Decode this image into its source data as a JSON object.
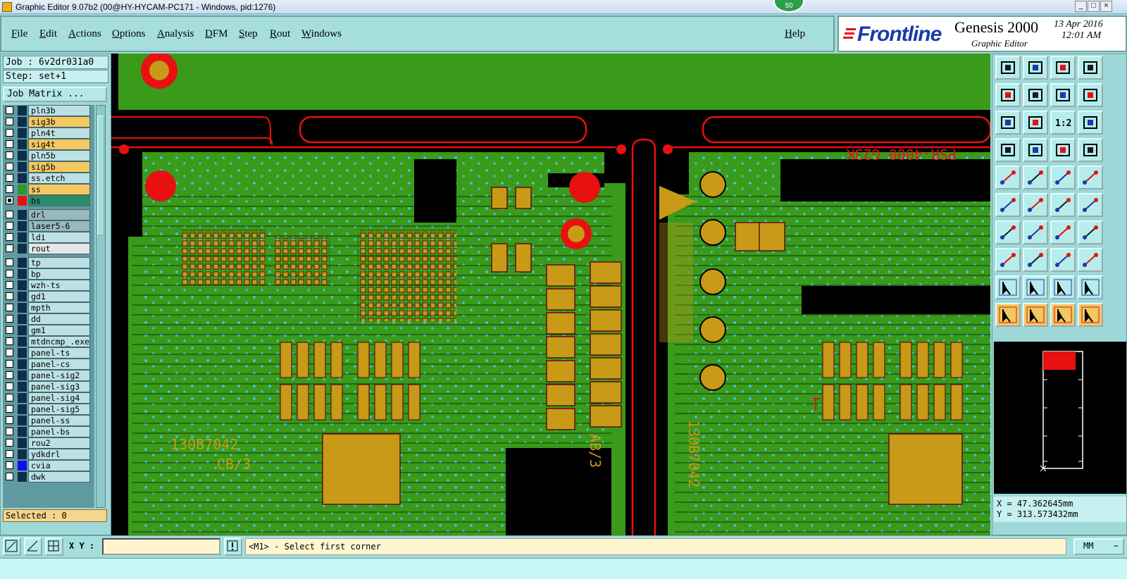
{
  "window": {
    "title": "Graphic Editor 9.07b2 (00@HY-HYCAM-PC171 - Windows, pid:1276)",
    "badge": "50",
    "controls": [
      "_",
      "□",
      "×"
    ]
  },
  "menu": [
    "File",
    "Edit",
    "Actions",
    "Options",
    "Analysis",
    "DFM",
    "Step",
    "Rout",
    "Windows"
  ],
  "help": "Help",
  "branding": {
    "logo": "Frontline",
    "product": "Genesis 2000",
    "subtitle": "Graphic Editor",
    "date": "13 Apr 2016",
    "time": "12:01 AM"
  },
  "job": {
    "job_line": "Job : 6v2dr031a0",
    "step_line": "Step: set+1",
    "matrix_button": "Job Matrix ..."
  },
  "layers": [
    {
      "name": "pln3b",
      "color": "#bde0e4",
      "checked": false
    },
    {
      "name": "sig3b",
      "color": "#f6c860",
      "checked": false
    },
    {
      "name": "pln4t",
      "color": "#bde0e4",
      "checked": false
    },
    {
      "name": "sig4t",
      "color": "#f6c860",
      "checked": false
    },
    {
      "name": "pln5b",
      "color": "#bde0e4",
      "checked": false
    },
    {
      "name": "sig5b",
      "color": "#f6c860",
      "checked": false
    },
    {
      "name": "ss.etch",
      "color": "#bde0e4",
      "checked": false
    },
    {
      "name": "ss",
      "color": "#f6c860",
      "checked": false,
      "swatch": "#2a9a2a"
    },
    {
      "name": "bs",
      "color": "#2f8a6a",
      "checked": true,
      "swatch": "#e81010"
    },
    {
      "name": "drl",
      "color": "#98b8bc",
      "checked": false
    },
    {
      "name": "laser5-6",
      "color": "#98b8bc",
      "checked": false
    },
    {
      "name": "ldi",
      "color": "#bde0e4",
      "checked": false
    },
    {
      "name": "rout",
      "color": "#e6e6e6",
      "checked": false
    },
    {
      "name": "tp",
      "color": "#bde0e4",
      "checked": false
    },
    {
      "name": "bp",
      "color": "#bde0e4",
      "checked": false
    },
    {
      "name": "wzh-ts",
      "color": "#bde0e4",
      "checked": false
    },
    {
      "name": "gd1",
      "color": "#bde0e4",
      "checked": false
    },
    {
      "name": "mpth",
      "color": "#bde0e4",
      "checked": false
    },
    {
      "name": "dd",
      "color": "#bde0e4",
      "checked": false
    },
    {
      "name": "gm1",
      "color": "#bde0e4",
      "checked": false
    },
    {
      "name": "mtdncmp_.exe",
      "color": "#bde0e4",
      "checked": false
    },
    {
      "name": "panel-ts",
      "color": "#bde0e4",
      "checked": false
    },
    {
      "name": "panel-cs",
      "color": "#bde0e4",
      "checked": false
    },
    {
      "name": "panel-sig2",
      "color": "#bde0e4",
      "checked": false
    },
    {
      "name": "panel-sig3",
      "color": "#bde0e4",
      "checked": false
    },
    {
      "name": "panel-sig4",
      "color": "#bde0e4",
      "checked": false
    },
    {
      "name": "panel-sig5",
      "color": "#bde0e4",
      "checked": false
    },
    {
      "name": "panel-ss",
      "color": "#bde0e4",
      "checked": false
    },
    {
      "name": "panel-bs",
      "color": "#bde0e4",
      "checked": false
    },
    {
      "name": "rou2",
      "color": "#bde0e4",
      "checked": false
    },
    {
      "name": "ydkdrl",
      "color": "#bde0e4",
      "checked": false
    },
    {
      "name": "cvia",
      "color": "#bde0e4",
      "checked": false,
      "swatch": "#1010e8"
    },
    {
      "name": "dwk",
      "color": "#bde0e4",
      "checked": false
    }
  ],
  "selected": "Selected : 0",
  "canvas_text": {
    "silk1": "PSR-4000 G23K",
    "silk2": "130B7042",
    "silk3": "CB/3",
    "silk4": "AB/3",
    "silk5": "130B7042"
  },
  "tools": [
    "layout-top-icon",
    "layout-bottom-icon",
    "home-icon",
    "split-view-icon",
    "pan-left-icon",
    "pan-right-icon",
    "zoom-window-icon",
    "redraw-icon",
    "zoom-fit-icon",
    "zoom-center-icon",
    "zoom-1-2-icon",
    "help-query-icon",
    "measure-tool-icon",
    "grid-icon",
    "layers-toggle-icon",
    "layers-toggle2-icon",
    "select-feature-icon",
    "select-net-icon",
    "ruler-icon",
    "pad-icon",
    "connect-icon",
    "delete-icon",
    "move-point-icon",
    "arc-icon",
    "line-draw-icon",
    "line-diagonal-icon",
    "rotate-icon",
    "mirror-icon",
    "snap-icon",
    "hline-icon",
    "hdimension-icon",
    "contour-icon",
    "triangle-select-icon",
    "triangle-select2-icon",
    "triangle-select3-icon",
    "triangle-select4-icon",
    "pointer-icon",
    "pointer-frame-icon",
    "pointer-circle-icon",
    "pointer-graph-icon"
  ],
  "one_two_label": "1:2",
  "coords": {
    "x": "X = 47.362645mm",
    "y": "Y = 313.573432mm"
  },
  "bottom": {
    "xy_label": "X Y :",
    "xy_value": "",
    "message": "<M1> - Select first corner",
    "units": "MM"
  },
  "colors": {
    "board_green": "#3a9a1a",
    "copper": "#c89a18",
    "outline_red": "#e81010",
    "via_cyan": "#40c8e8"
  }
}
